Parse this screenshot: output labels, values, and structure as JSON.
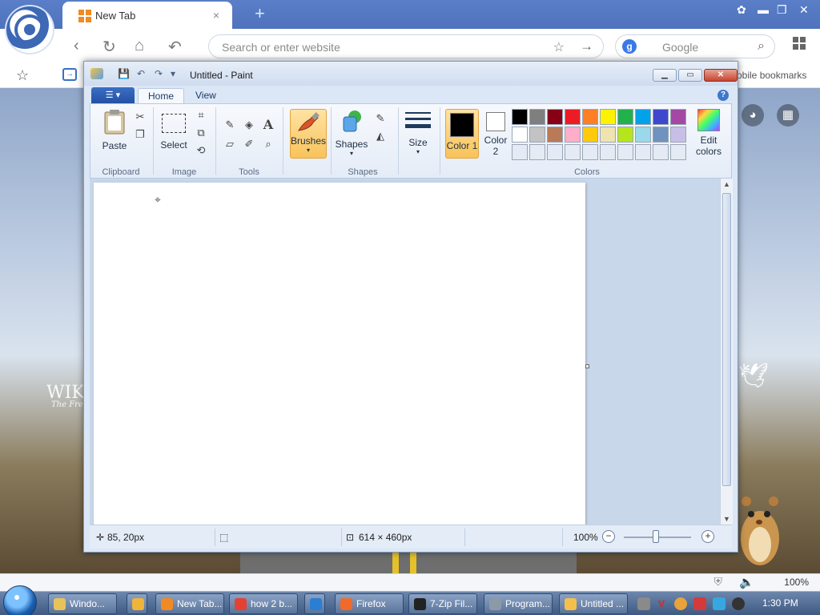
{
  "browser": {
    "tab_title": "New Tab",
    "tab_close": "×",
    "new_tab": "+",
    "address_placeholder": "Search or enter website",
    "search_engine_placeholder": "Google",
    "search_engine_logo": "g",
    "bookmark_mobile": "obile bookmarks",
    "window_min": "▬",
    "window_restore": "❐",
    "window_close": "✕",
    "zoom": "100%"
  },
  "page": {
    "wiki_text": "WIKI",
    "wiki_sub": "The Free"
  },
  "paint": {
    "title": "Untitled - Paint",
    "tabs": [
      "Home",
      "View"
    ],
    "help": "?",
    "clipboard": {
      "paste": "Paste",
      "label": "Clipboard"
    },
    "image": {
      "select": "Select",
      "label": "Image"
    },
    "tools": {
      "label": "Tools"
    },
    "brushes": "Brushes",
    "shapes": {
      "button": "Shapes",
      "label": "Shapes"
    },
    "size": "Size",
    "color1": "Color 1",
    "color2": "Color 2",
    "colors_label": "Colors",
    "edit_colors": "Edit colors",
    "palette_row1": [
      "#000000",
      "#7f7f7f",
      "#880015",
      "#ed1c24",
      "#ff7f27",
      "#fff200",
      "#22b14c",
      "#00a2e8",
      "#3f48cc",
      "#a349a4"
    ],
    "palette_row2": [
      "#ffffff",
      "#c3c3c3",
      "#b97a57",
      "#ffaec9",
      "#ffc90e",
      "#efe4b0",
      "#b5e61d",
      "#99d9ea",
      "#7092be",
      "#c8bfe7"
    ],
    "palette_row3_empty_color": "#e4ebf4",
    "color1_value": "#000000",
    "color2_value": "#ffffff",
    "status": {
      "cursor_pos": "85, 20px",
      "canvas_size": "614 × 460px",
      "zoom": "100%"
    }
  },
  "taskbar": {
    "items": [
      {
        "label": "Windo...",
        "color": "#e8c35a"
      },
      {
        "label": "",
        "color": "#f0b43a"
      },
      {
        "label": "New Tab...",
        "color": "#f08a24"
      },
      {
        "label": "how 2 b...",
        "color": "#e34133"
      },
      {
        "label": "",
        "color": "#2a7fd4"
      },
      {
        "label": "Firefox",
        "color": "#f06a2a"
      },
      {
        "label": "7-Zip Fil...",
        "color": "#222222"
      },
      {
        "label": "Program...",
        "color": "#8c9aa8"
      },
      {
        "label": "Untitled ...",
        "color": "#f3c14b"
      }
    ],
    "clock": "1:30 PM"
  }
}
